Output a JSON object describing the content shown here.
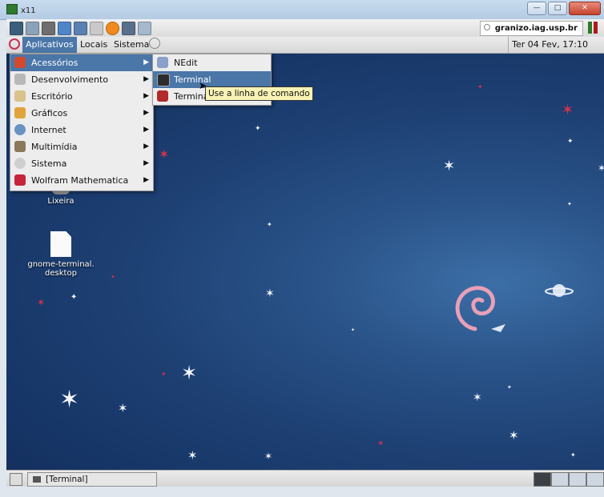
{
  "window": {
    "title": "x11"
  },
  "toolbar": {
    "icons": [
      "terminal-icon",
      "window-icon",
      "tools-icon",
      "refresh-icon",
      "edit-icon",
      "print-icon",
      "alert-icon",
      "network-icon",
      "fullscreen-icon"
    ],
    "host": "granizo.iag.usp.br"
  },
  "panel": {
    "menus": [
      "Aplicativos",
      "Locais",
      "Sistema"
    ],
    "clock": "Ter 04 Fev, 17:10"
  },
  "apps_menu": {
    "items": [
      {
        "label": "Acessórios",
        "icon": "accessories-icon"
      },
      {
        "label": "Desenvolvimento",
        "icon": "development-icon"
      },
      {
        "label": "Escritório",
        "icon": "office-icon"
      },
      {
        "label": "Gráficos",
        "icon": "graphics-icon"
      },
      {
        "label": "Internet",
        "icon": "internet-icon"
      },
      {
        "label": "Multimídia",
        "icon": "multimedia-icon"
      },
      {
        "label": "Sistema",
        "icon": "system-icon"
      },
      {
        "label": "Wolfram Mathematica",
        "icon": "mathematica-icon"
      }
    ]
  },
  "submenu": {
    "items": [
      {
        "label": "NEdit",
        "icon": "nedit-icon"
      },
      {
        "label": "Terminal",
        "icon": "terminal-icon"
      },
      {
        "label": "Terminal",
        "icon": "terminal-icon"
      }
    ]
  },
  "tooltip": {
    "text": "Use a linha de comando"
  },
  "desktop": {
    "icons": [
      {
        "label": "Lixeira",
        "icon": "trash-icon"
      },
      {
        "label": "gnome-terminal.\ndesktop",
        "icon": "file-icon"
      }
    ]
  },
  "taskbar": {
    "task": "[Terminal]"
  },
  "colors": {
    "menu_highlight": "#4a76a8",
    "desktop_blue": "#1d3f72",
    "tooltip": "#f8f3b4"
  }
}
